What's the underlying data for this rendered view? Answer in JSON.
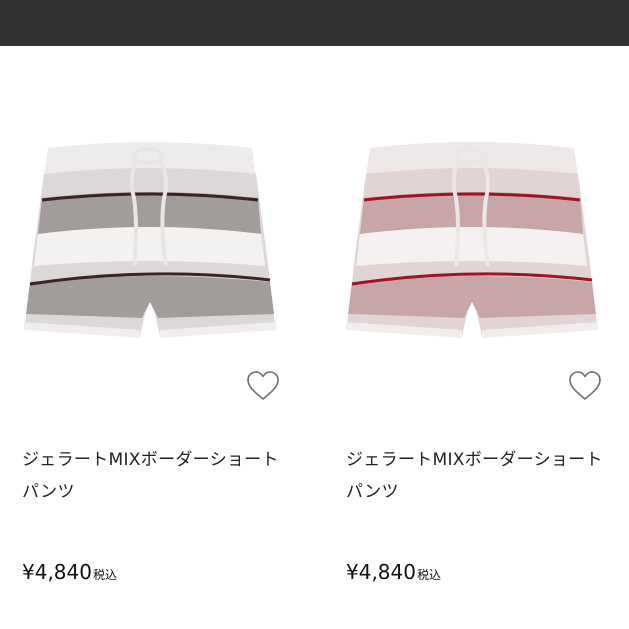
{
  "products": [
    {
      "name": "ジェラートMIXボーダーショートパンツ",
      "price": "¥4,840",
      "tax_label": "税込",
      "favorite_icon": "heart-outline-icon",
      "image": "gray-striped-fluffy-shorts",
      "stripe_color": "#3a2426",
      "band_color": "#a29c9a"
    },
    {
      "name": "ジェラートMIXボーダーショートパンツ",
      "price": "¥4,840",
      "tax_label": "税込",
      "favorite_icon": "heart-outline-icon",
      "image": "pink-striped-fluffy-shorts",
      "stripe_color": "#9e1326",
      "band_color": "#c7a6a8"
    }
  ],
  "colors": {
    "topbar": "#333333",
    "background": "#ffffff"
  }
}
